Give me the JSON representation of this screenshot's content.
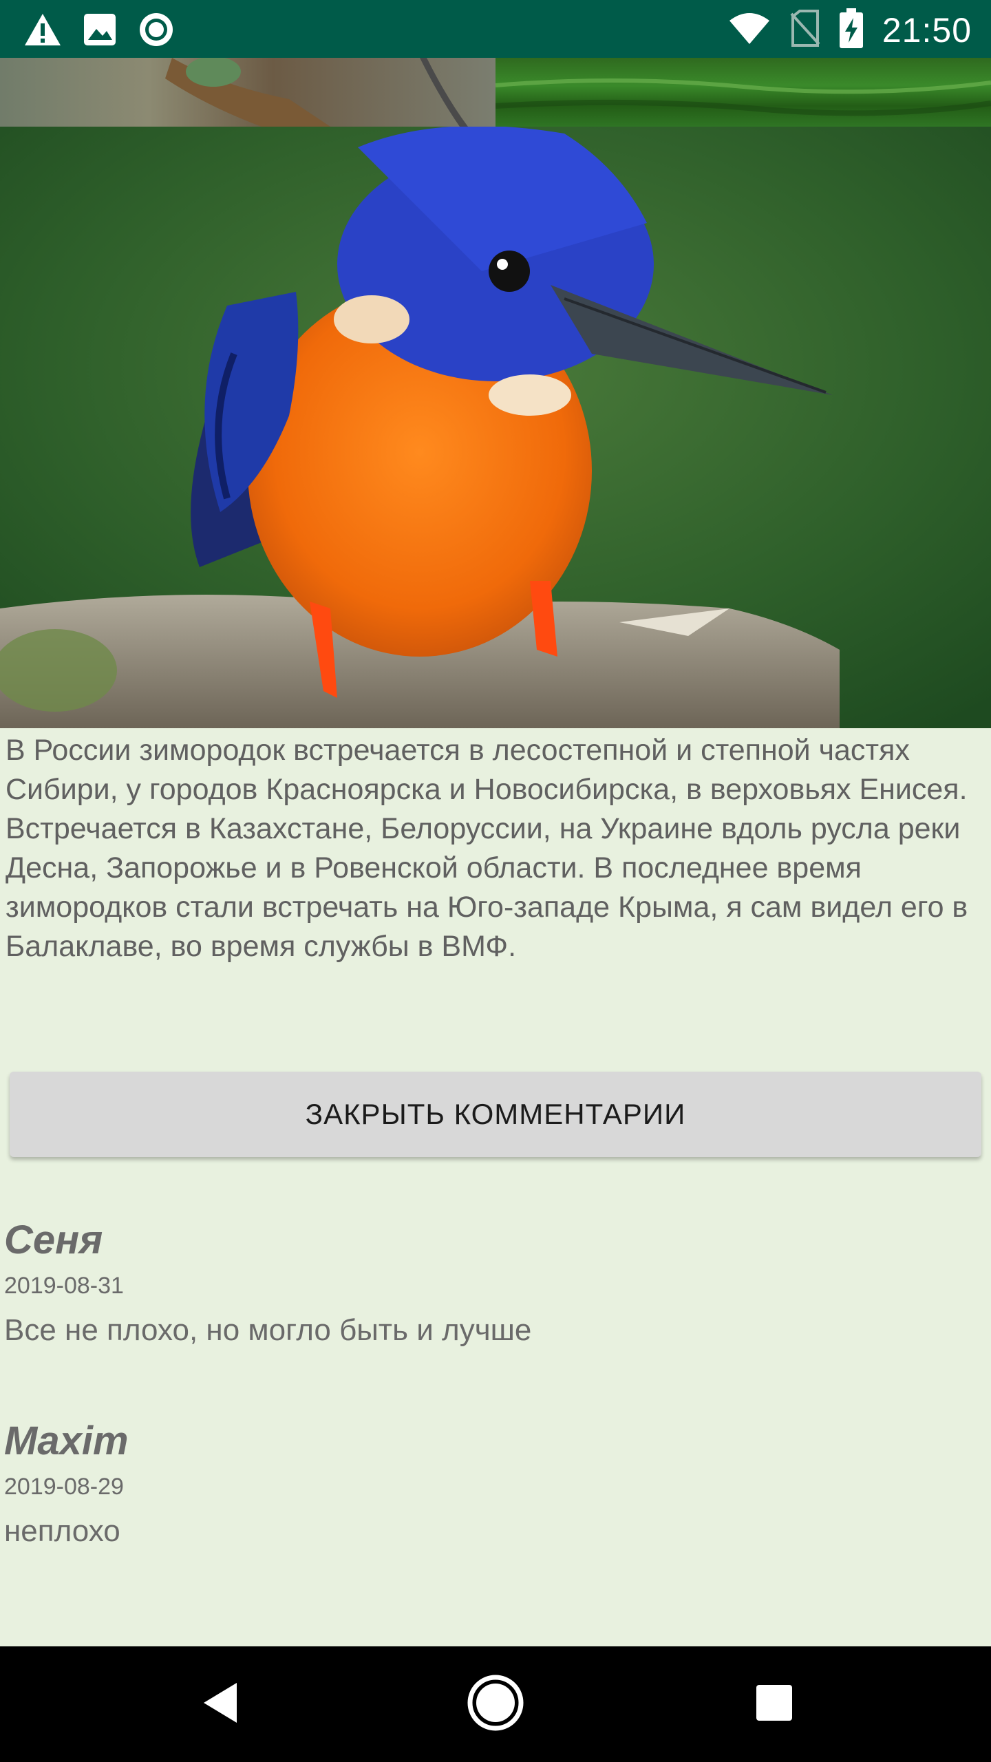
{
  "status_bar": {
    "time": "21:50",
    "icons": [
      "warning-icon",
      "image-icon",
      "sync-circle-icon",
      "wifi-icon",
      "no-sim-icon",
      "battery-charging-icon"
    ]
  },
  "article": {
    "text": " В России зимородок встречается в лесостепной и степной частях Сибири, у городов Красноярска и Новосибирска, в верховьях Енисея. Встречается в Казахстане, Белоруссии, на Украине вдоль русла реки Десна, Запорожье и в Ровенской области. В последнее время зимородков стали встречать на Юго-западе Крыма, я сам видел его в Балаклаве, во время службы в ВМФ."
  },
  "close_comments_button": {
    "label": "ЗАКРЫТЬ КОММЕНТАРИИ"
  },
  "comments": [
    {
      "author": "Сеня",
      "date": "2019-08-31",
      "text": "Все не плохо, но могло быть и лучше"
    },
    {
      "author": "Maxim",
      "date": "2019-08-29",
      "text": "неплохо"
    }
  ],
  "nav_bar": {
    "buttons": [
      "back-icon",
      "home-icon",
      "recents-icon"
    ]
  },
  "colors": {
    "status_bar": "#005b49",
    "page_background": "#e8f1df",
    "button_background": "#d8d8d8",
    "text": "#606060"
  }
}
